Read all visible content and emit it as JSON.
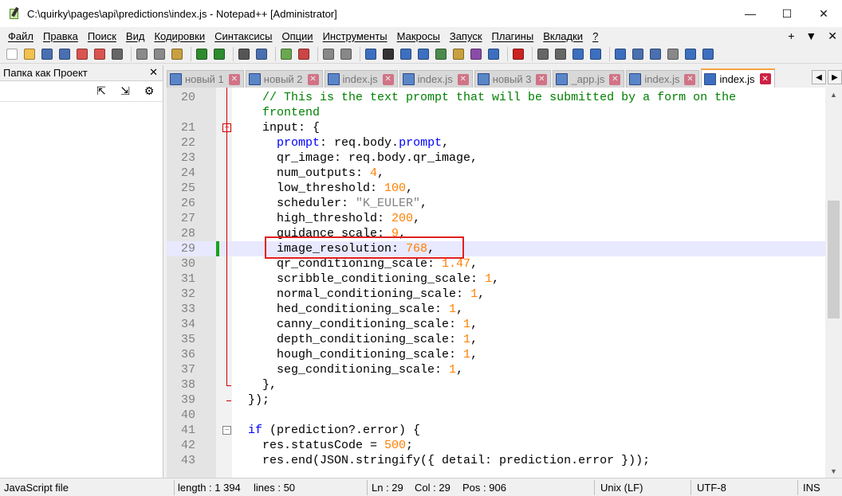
{
  "window": {
    "title": "C:\\quirky\\pages\\api\\predictions\\index.js - Notepad++ [Administrator]",
    "minimize": "—",
    "maximize": "☐",
    "close": "✕"
  },
  "menu": {
    "items": [
      "Файл",
      "Правка",
      "Поиск",
      "Вид",
      "Кодировки",
      "Синтаксисы",
      "Опции",
      "Инструменты",
      "Макросы",
      "Запуск",
      "Плагины",
      "Вкладки",
      "?"
    ],
    "right": [
      "+",
      "▼",
      "✕"
    ]
  },
  "toolbar": {
    "icons": [
      "new-file-icon",
      "open-file-icon",
      "save-icon",
      "save-all-icon",
      "close-icon",
      "close-all-icon",
      "print-icon",
      "cut-icon",
      "copy-icon",
      "paste-icon",
      "undo-icon",
      "redo-icon",
      "find-icon",
      "replace-icon",
      "zoom-in-icon",
      "zoom-out-icon",
      "sync-v-icon",
      "sync-h-icon",
      "wrap-icon",
      "all-chars-icon",
      "indent-guide-icon",
      "udl-icon",
      "doc-map-icon",
      "func-list-icon",
      "folder-workspace-icon",
      "monitor-icon",
      "record-macro-icon",
      "stop-macro-icon",
      "play-macro-icon",
      "play-multi-icon",
      "save-macro-icon",
      "spell-icon",
      "compare-icon",
      "diff-icon",
      "clear-icon",
      "up-icon",
      "down-icon"
    ],
    "colors": [
      "#ffffff",
      "#f2c14e",
      "#4a6fb0",
      "#4a6fb0",
      "#d9534f",
      "#d9534f",
      "#666666",
      "#8a8a8a",
      "#8a8a8a",
      "#c8a040",
      "#2e8b2e",
      "#2e8b2e",
      "#555555",
      "#4a6fb0",
      "#6aa84f",
      "#cc4444",
      "#888888",
      "#888888",
      "#3d6fc0",
      "#333333",
      "#3d6fc0",
      "#3d6fc0",
      "#4a8a4a",
      "#c8a040",
      "#8a4aa8",
      "#3d6fc0",
      "#cc2222",
      "#666666",
      "#666666",
      "#3d6fc0",
      "#3d6fc0",
      "#3d6fc0",
      "#4a6fb0",
      "#4a6fb0",
      "#888888",
      "#3d6fc0",
      "#3d6fc0"
    ]
  },
  "panel": {
    "title": "Папка как Проект",
    "close": "✕",
    "tools": [
      "⇱",
      "⇲",
      "⚙"
    ]
  },
  "tabs": [
    {
      "label": "новый 1",
      "active": false
    },
    {
      "label": "новый 2",
      "active": false
    },
    {
      "label": "index.js",
      "active": false
    },
    {
      "label": "index.js",
      "active": false
    },
    {
      "label": "новый 3",
      "active": false
    },
    {
      "label": "_app.js",
      "active": false
    },
    {
      "label": "index.js",
      "active": false
    },
    {
      "label": "index.js",
      "active": true
    }
  ],
  "tab_nav": [
    "◀",
    "▶"
  ],
  "editor": {
    "lines": [
      {
        "n": "20",
        "tokens": [
          [
            "c",
            "    // This is the text prompt that will be submitted by a form on the"
          ]
        ]
      },
      {
        "n": "",
        "tokens": [
          [
            "c",
            "    frontend"
          ]
        ]
      },
      {
        "n": "21",
        "tokens": [
          [
            "o",
            "    input: {"
          ]
        ]
      },
      {
        "n": "22",
        "tokens": [
          [
            "o",
            "      "
          ],
          [
            "k",
            "prompt"
          ],
          [
            "o",
            ": req.body."
          ],
          [
            "k",
            "prompt"
          ],
          [
            "o",
            ","
          ]
        ]
      },
      {
        "n": "23",
        "tokens": [
          [
            "o",
            "      qr_image: req.body.qr_image,"
          ]
        ]
      },
      {
        "n": "24",
        "tokens": [
          [
            "o",
            "      num_outputs: "
          ],
          [
            "n",
            "4"
          ],
          [
            "o",
            ","
          ]
        ]
      },
      {
        "n": "25",
        "tokens": [
          [
            "o",
            "      low_threshold: "
          ],
          [
            "n",
            "100"
          ],
          [
            "o",
            ","
          ]
        ]
      },
      {
        "n": "26",
        "tokens": [
          [
            "o",
            "      scheduler: "
          ],
          [
            "s",
            "\"K_EULER\""
          ],
          [
            "o",
            ","
          ]
        ]
      },
      {
        "n": "27",
        "tokens": [
          [
            "o",
            "      high_threshold: "
          ],
          [
            "n",
            "200"
          ],
          [
            "o",
            ","
          ]
        ]
      },
      {
        "n": "28",
        "tokens": [
          [
            "o",
            "      guidance_scale: "
          ],
          [
            "n",
            "9"
          ],
          [
            "o",
            ","
          ]
        ]
      },
      {
        "n": "29",
        "tokens": [
          [
            "o",
            "      image_resolution: "
          ],
          [
            "n",
            "768"
          ],
          [
            "o",
            ","
          ]
        ]
      },
      {
        "n": "30",
        "tokens": [
          [
            "o",
            "      qr_conditioning_scale: "
          ],
          [
            "n",
            "1.47"
          ],
          [
            "o",
            ","
          ]
        ]
      },
      {
        "n": "31",
        "tokens": [
          [
            "o",
            "      scribble_conditioning_scale: "
          ],
          [
            "n",
            "1"
          ],
          [
            "o",
            ","
          ]
        ]
      },
      {
        "n": "32",
        "tokens": [
          [
            "o",
            "      normal_conditioning_scale: "
          ],
          [
            "n",
            "1"
          ],
          [
            "o",
            ","
          ]
        ]
      },
      {
        "n": "33",
        "tokens": [
          [
            "o",
            "      hed_conditioning_scale: "
          ],
          [
            "n",
            "1"
          ],
          [
            "o",
            ","
          ]
        ]
      },
      {
        "n": "34",
        "tokens": [
          [
            "o",
            "      canny_conditioning_scale: "
          ],
          [
            "n",
            "1"
          ],
          [
            "o",
            ","
          ]
        ]
      },
      {
        "n": "35",
        "tokens": [
          [
            "o",
            "      depth_conditioning_scale: "
          ],
          [
            "n",
            "1"
          ],
          [
            "o",
            ","
          ]
        ]
      },
      {
        "n": "36",
        "tokens": [
          [
            "o",
            "      hough_conditioning_scale: "
          ],
          [
            "n",
            "1"
          ],
          [
            "o",
            ","
          ]
        ]
      },
      {
        "n": "37",
        "tokens": [
          [
            "o",
            "      seg_conditioning_scale: "
          ],
          [
            "n",
            "1"
          ],
          [
            "o",
            ","
          ]
        ]
      },
      {
        "n": "38",
        "tokens": [
          [
            "o",
            "    },"
          ]
        ]
      },
      {
        "n": "39",
        "tokens": [
          [
            "o",
            "  });"
          ]
        ]
      },
      {
        "n": "40",
        "tokens": [
          [
            "o",
            ""
          ]
        ]
      },
      {
        "n": "41",
        "tokens": [
          [
            "o",
            "  "
          ],
          [
            "k",
            "if"
          ],
          [
            "o",
            " (prediction?.error) {"
          ]
        ]
      },
      {
        "n": "42",
        "tokens": [
          [
            "o",
            "    res.statusCode = "
          ],
          [
            "n",
            "500"
          ],
          [
            "o",
            ";"
          ]
        ]
      },
      {
        "n": "43",
        "tokens": [
          [
            "o",
            "    res.end(JSON.stringify({ detail: prediction.error }));"
          ]
        ]
      }
    ],
    "current_line_index": 10
  },
  "scrollbar": {
    "up": "▲",
    "down": "▼"
  },
  "status": {
    "file_type": "JavaScript file",
    "length": "length : 1 394",
    "lines": "lines : 50",
    "ln": "Ln : 29",
    "col": "Col : 29",
    "pos": "Pos : 906",
    "eol": "Unix (LF)",
    "encoding": "UTF-8",
    "mode": "INS"
  }
}
